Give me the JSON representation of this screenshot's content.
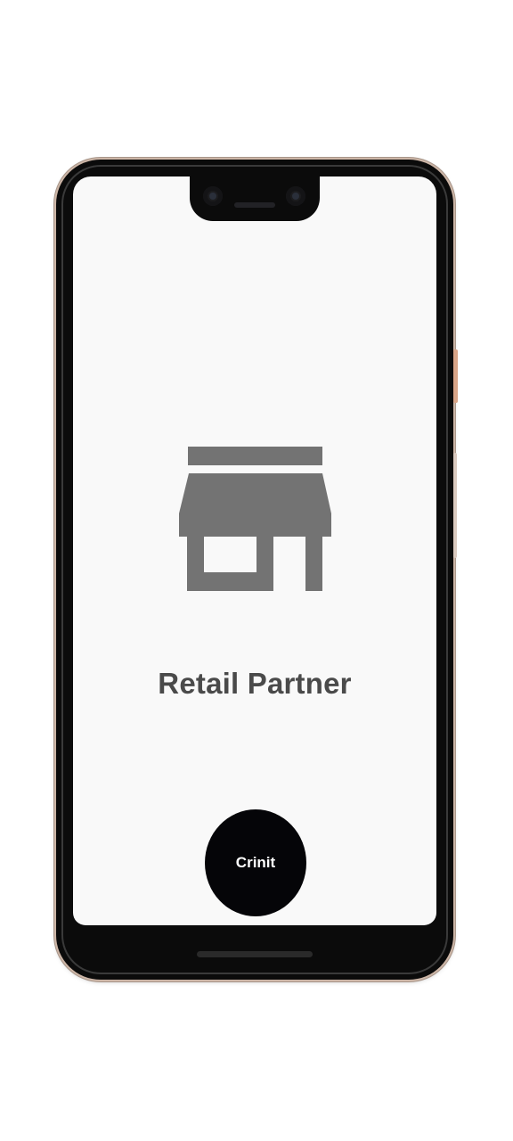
{
  "screen": {
    "icon": "storefront-icon",
    "title": "Retail Partner",
    "action_button_label": "Crinit"
  },
  "colors": {
    "screen_background": "#f9f9f9",
    "icon_color": "#737373",
    "title_color": "#4a4a4a",
    "button_background": "#050508",
    "button_text": "#ffffff",
    "device_frame": "#0b0b0b"
  }
}
